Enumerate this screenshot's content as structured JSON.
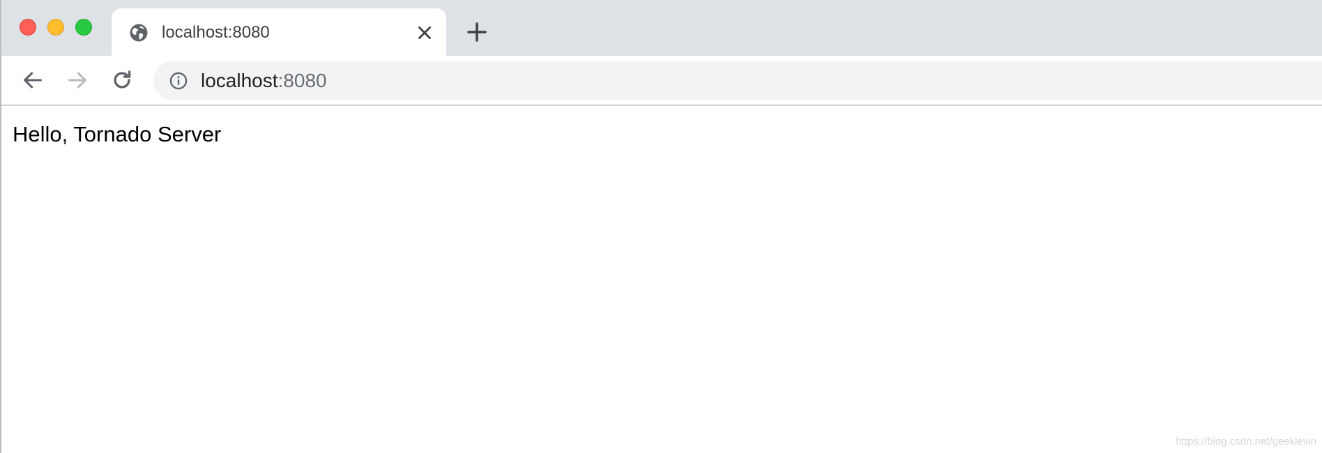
{
  "window_controls": {
    "close_color": "#fe5f57",
    "minimize_color": "#febc2e",
    "maximize_color": "#28c840"
  },
  "tab": {
    "title": "localhost:8080",
    "icon": "globe-icon",
    "close_icon": "close-icon"
  },
  "new_tab": {
    "icon": "plus-icon"
  },
  "toolbar": {
    "back_icon": "arrow-left-icon",
    "forward_icon": "arrow-right-icon",
    "forward_enabled": false,
    "reload_icon": "reload-icon"
  },
  "address_bar": {
    "security_icon": "info-icon",
    "host": "localhost",
    "port": ":8080"
  },
  "page": {
    "text": "Hello, Tornado Server"
  },
  "watermark": "https://blog.csdn.net/geeklevin"
}
